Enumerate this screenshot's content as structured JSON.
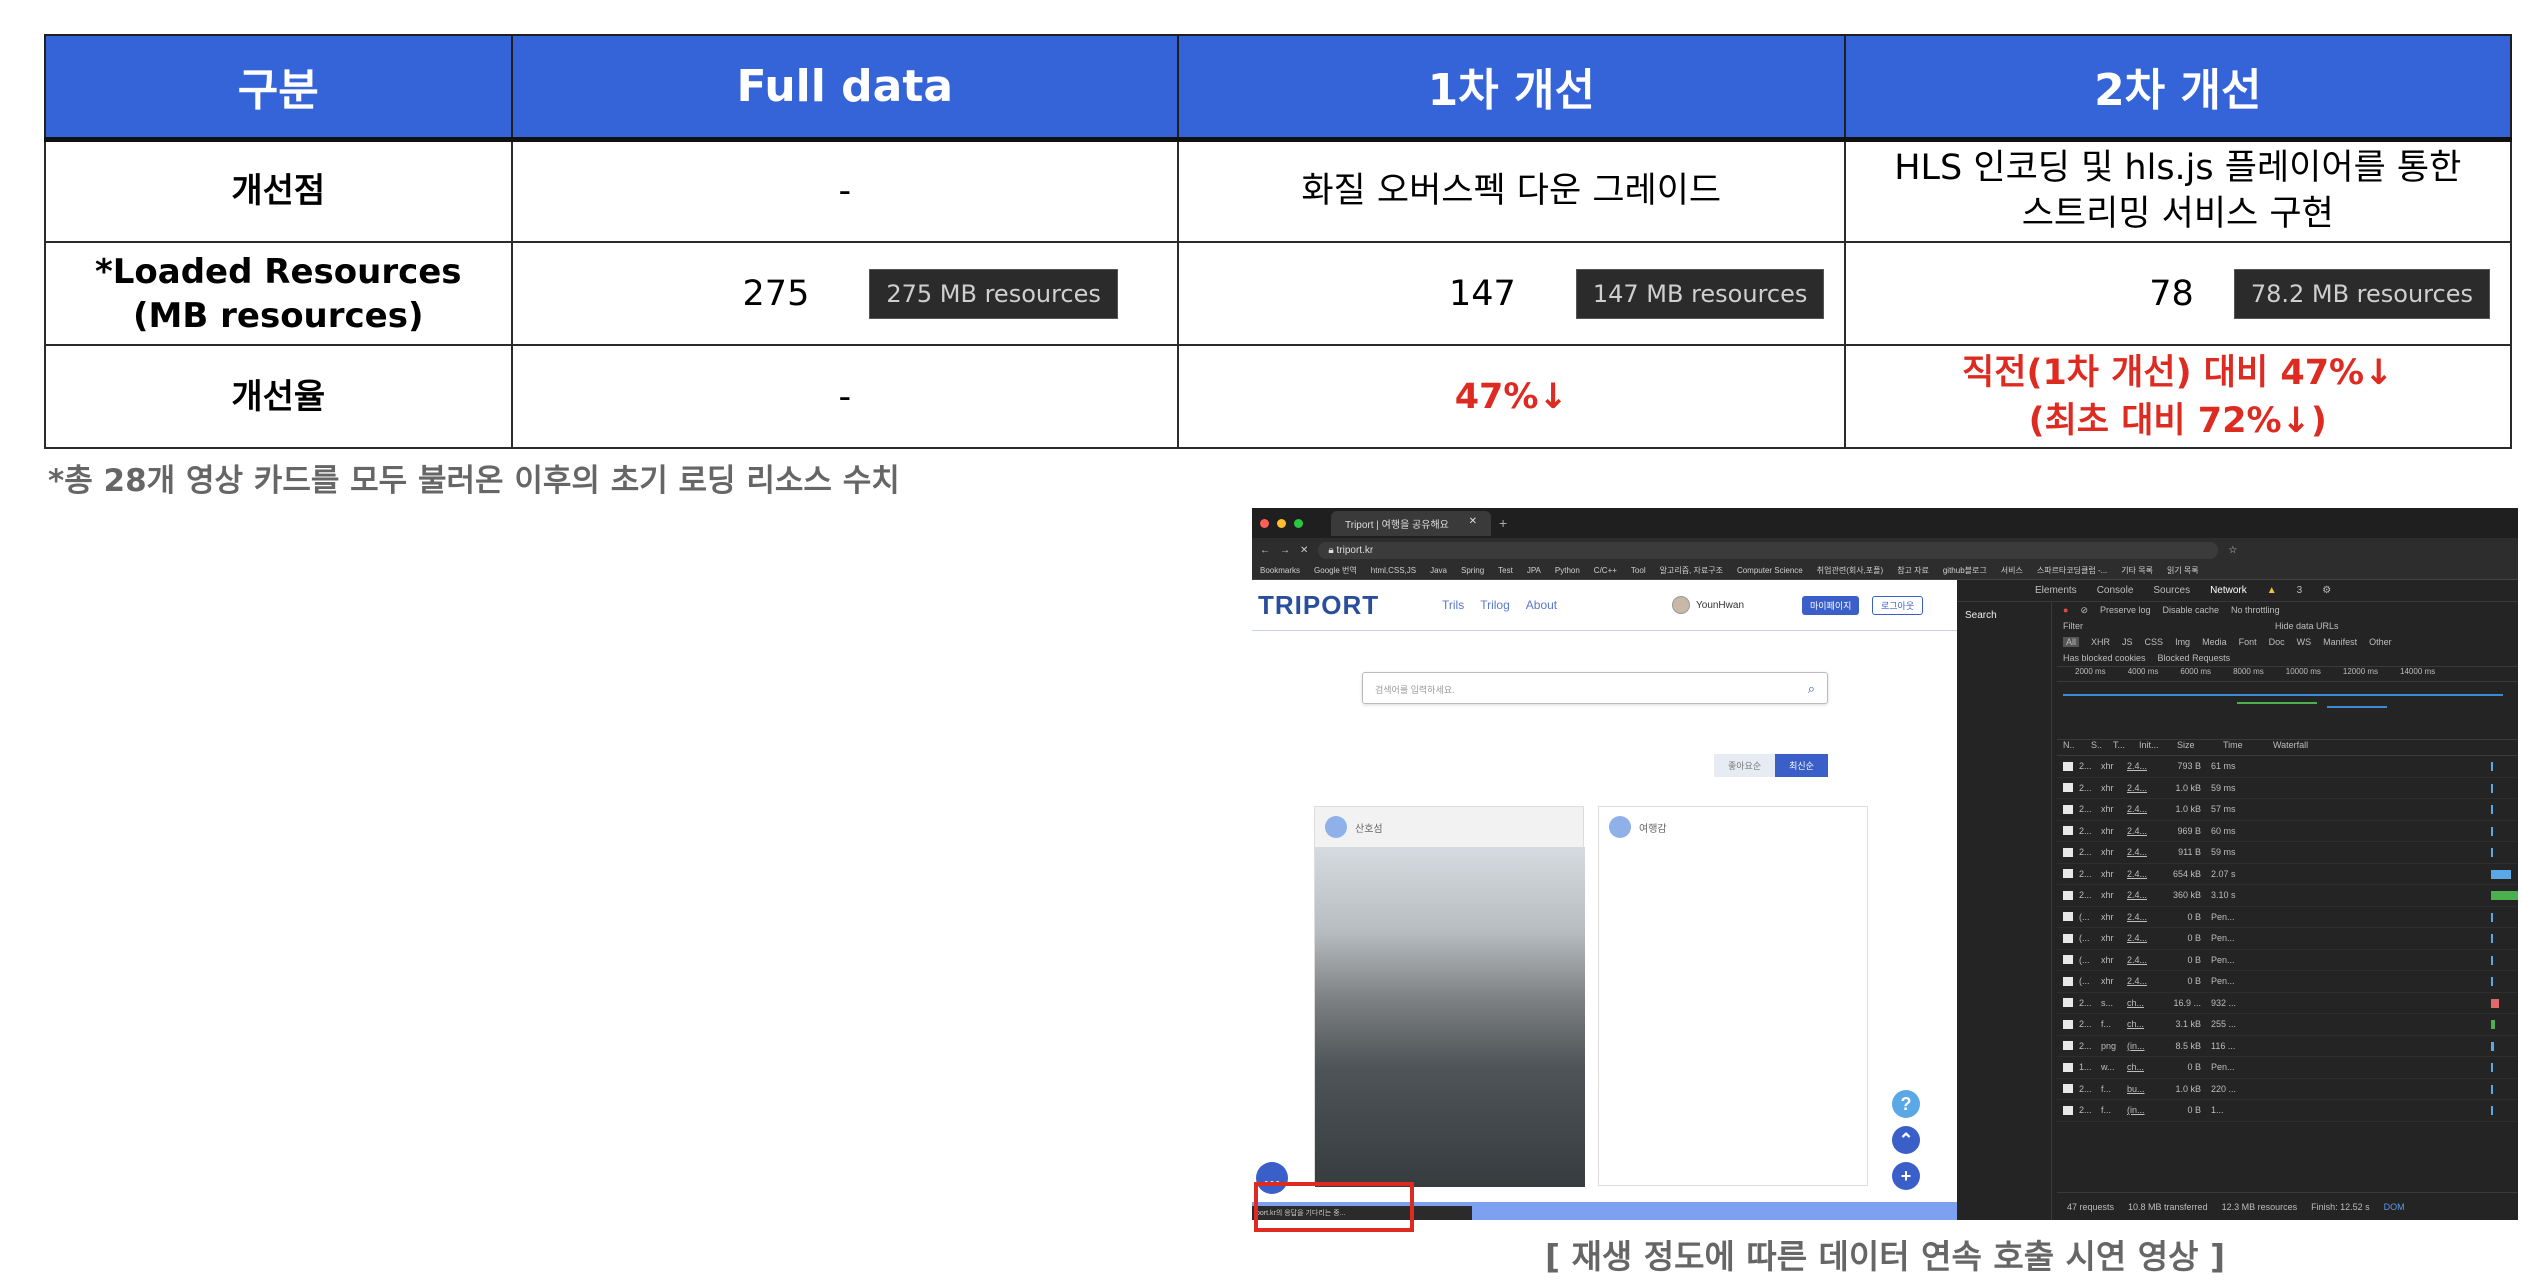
{
  "table": {
    "headers": [
      "구분",
      "Full data",
      "1차 개선",
      "2차 개선"
    ],
    "rows": {
      "improvement": {
        "label": "개선점",
        "full": "-",
        "first": "화질 오버스펙 다운 그레이드",
        "second_l1": "HLS 인코딩 및 hls.js 플레이어를 통한",
        "second_l2": "스트리밍 서비스 구현"
      },
      "resources": {
        "label_l1": "*Loaded Resources",
        "label_l2": "(MB resources)",
        "full": {
          "num": "275",
          "pill": "275 MB resources"
        },
        "first": {
          "num": "147",
          "pill": "147 MB resources"
        },
        "second": {
          "num": "78",
          "pill": "78.2 MB resources"
        }
      },
      "rate": {
        "label": "개선율",
        "full": "-",
        "first": "47%↓",
        "second_l1": "직전(1차 개선) 대비 47%↓",
        "second_l2": "(최초 대비 72%↓)"
      }
    },
    "colors": {
      "header_bg": "#3563d8",
      "accent_red": "#dd2b22"
    }
  },
  "footnote": "*총 28개 영상 카드를 모두 불러온 이후의 초기 로딩 리소스 수치",
  "screenshot": {
    "tab_title": "Triport | 여행을 공유해요",
    "url": "triport.kr",
    "bookmarks": [
      "Bookmarks",
      "Google 번역",
      "html,CSS,JS",
      "Java",
      "Spring",
      "Test",
      "JPA",
      "Python",
      "C/C++",
      "Tool",
      "알고리즘, 자료구조",
      "Computer Science",
      "취업관련(회사,포폴)",
      "참고 자료",
      "github블로그",
      "서비스",
      "스파르타코딩클럽 -...",
      "기타 목록",
      "읽기 목록"
    ],
    "page": {
      "logo": "TRIPORT",
      "nav": [
        "Trils",
        "Trilog",
        "About"
      ],
      "user": "YounHwan",
      "btn_mypage": "마이페이지",
      "btn_logout": "로그아웃",
      "search_placeholder": "검색어를 입력하세요.",
      "sort_popular": "좋아요순",
      "sort_latest": "최신순",
      "card1_user": "산호섬",
      "card2_user": "여행감",
      "status_text": "port.kr의 응답을 기다리는 중..."
    },
    "devtools": {
      "tabs": [
        "Elements",
        "Console",
        "Sources",
        "Network"
      ],
      "warn_count": "3",
      "side_search": "Search",
      "preserve": "Preserve log",
      "disable": "Disable cache",
      "throttle": "No throttling",
      "filter": "Filter",
      "hide_urls": "Hide data URLs",
      "types": [
        "All",
        "XHR",
        "JS",
        "CSS",
        "Img",
        "Media",
        "Font",
        "Doc",
        "WS",
        "Manifest",
        "Other"
      ],
      "blocked_cookies": "Has blocked cookies",
      "blocked_req": "Blocked Requests",
      "ruler": [
        "2000 ms",
        "4000 ms",
        "6000 ms",
        "8000 ms",
        "10000 ms",
        "12000 ms",
        "14000 ms"
      ],
      "grid_headers": [
        "N..",
        "S..",
        "T...",
        "Init...",
        "Size",
        "Time",
        "Waterfall"
      ],
      "rows": [
        [
          "2...",
          "xhr",
          "2.4...",
          "793 B",
          "61 ms"
        ],
        [
          "2...",
          "xhr",
          "2.4...",
          "1.0 kB",
          "59 ms"
        ],
        [
          "2...",
          "xhr",
          "2.4...",
          "1.0 kB",
          "57 ms"
        ],
        [
          "2...",
          "xhr",
          "2.4...",
          "969 B",
          "60 ms"
        ],
        [
          "2...",
          "xhr",
          "2.4...",
          "911 B",
          "59 ms"
        ],
        [
          "2...",
          "xhr",
          "2.4...",
          "654 kB",
          "2.07 s"
        ],
        [
          "2...",
          "xhr",
          "2.4...",
          "360 kB",
          "3.10 s"
        ],
        [
          "(...",
          "xhr",
          "2.4...",
          "0 B",
          "Pen..."
        ],
        [
          "(...",
          "xhr",
          "2.4...",
          "0 B",
          "Pen..."
        ],
        [
          "(...",
          "xhr",
          "2.4...",
          "0 B",
          "Pen..."
        ],
        [
          "(...",
          "xhr",
          "2.4...",
          "0 B",
          "Pen..."
        ],
        [
          "2...",
          "s...",
          "ch...",
          "16.9 ...",
          "932 ..."
        ],
        [
          "2...",
          "f...",
          "ch...",
          "3.1 kB",
          "255 ..."
        ],
        [
          "2...",
          "png",
          "(in...",
          "8.5 kB",
          "116 ..."
        ],
        [
          "1...",
          "w...",
          "ch...",
          "0 B",
          "Pen..."
        ],
        [
          "2...",
          "f...",
          "bu...",
          "1.0 kB",
          "220 ..."
        ],
        [
          "2...",
          "f...",
          "(in...",
          "0 B",
          "1..."
        ]
      ],
      "footer": {
        "requests": "47 requests",
        "transferred": "10.8 MB transferred",
        "resources": "12.3 MB resources",
        "finish": "Finish: 12.52 s",
        "dom": "DOM"
      }
    }
  },
  "caption": "[ 재생 정도에 따른 데이터 연속 호출 시연 영상 ]"
}
